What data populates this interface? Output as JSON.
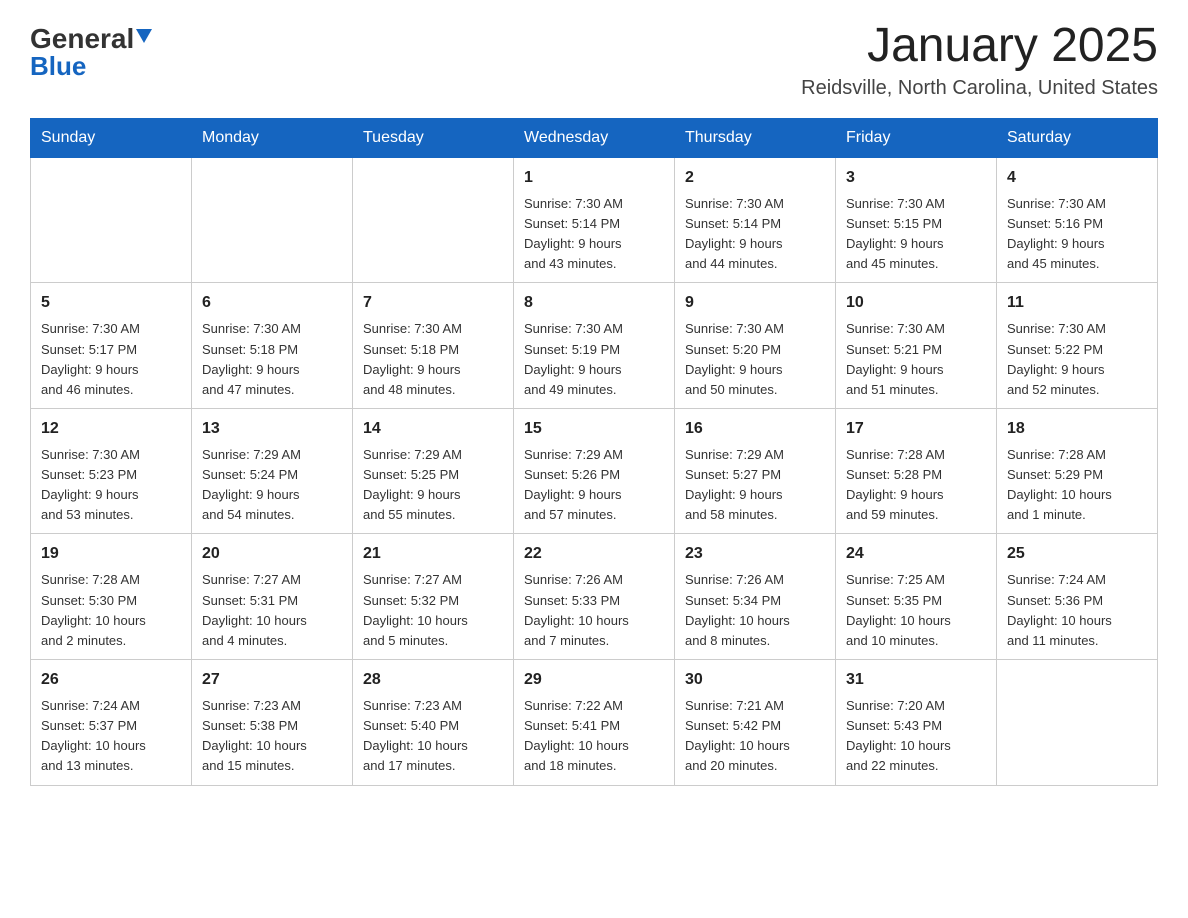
{
  "logo": {
    "brand": "General",
    "brand_color": "Blue"
  },
  "title": "January 2025",
  "subtitle": "Reidsville, North Carolina, United States",
  "days_of_week": [
    "Sunday",
    "Monday",
    "Tuesday",
    "Wednesday",
    "Thursday",
    "Friday",
    "Saturday"
  ],
  "weeks": [
    [
      {
        "day": "",
        "info": ""
      },
      {
        "day": "",
        "info": ""
      },
      {
        "day": "",
        "info": ""
      },
      {
        "day": "1",
        "info": "Sunrise: 7:30 AM\nSunset: 5:14 PM\nDaylight: 9 hours\nand 43 minutes."
      },
      {
        "day": "2",
        "info": "Sunrise: 7:30 AM\nSunset: 5:14 PM\nDaylight: 9 hours\nand 44 minutes."
      },
      {
        "day": "3",
        "info": "Sunrise: 7:30 AM\nSunset: 5:15 PM\nDaylight: 9 hours\nand 45 minutes."
      },
      {
        "day": "4",
        "info": "Sunrise: 7:30 AM\nSunset: 5:16 PM\nDaylight: 9 hours\nand 45 minutes."
      }
    ],
    [
      {
        "day": "5",
        "info": "Sunrise: 7:30 AM\nSunset: 5:17 PM\nDaylight: 9 hours\nand 46 minutes."
      },
      {
        "day": "6",
        "info": "Sunrise: 7:30 AM\nSunset: 5:18 PM\nDaylight: 9 hours\nand 47 minutes."
      },
      {
        "day": "7",
        "info": "Sunrise: 7:30 AM\nSunset: 5:18 PM\nDaylight: 9 hours\nand 48 minutes."
      },
      {
        "day": "8",
        "info": "Sunrise: 7:30 AM\nSunset: 5:19 PM\nDaylight: 9 hours\nand 49 minutes."
      },
      {
        "day": "9",
        "info": "Sunrise: 7:30 AM\nSunset: 5:20 PM\nDaylight: 9 hours\nand 50 minutes."
      },
      {
        "day": "10",
        "info": "Sunrise: 7:30 AM\nSunset: 5:21 PM\nDaylight: 9 hours\nand 51 minutes."
      },
      {
        "day": "11",
        "info": "Sunrise: 7:30 AM\nSunset: 5:22 PM\nDaylight: 9 hours\nand 52 minutes."
      }
    ],
    [
      {
        "day": "12",
        "info": "Sunrise: 7:30 AM\nSunset: 5:23 PM\nDaylight: 9 hours\nand 53 minutes."
      },
      {
        "day": "13",
        "info": "Sunrise: 7:29 AM\nSunset: 5:24 PM\nDaylight: 9 hours\nand 54 minutes."
      },
      {
        "day": "14",
        "info": "Sunrise: 7:29 AM\nSunset: 5:25 PM\nDaylight: 9 hours\nand 55 minutes."
      },
      {
        "day": "15",
        "info": "Sunrise: 7:29 AM\nSunset: 5:26 PM\nDaylight: 9 hours\nand 57 minutes."
      },
      {
        "day": "16",
        "info": "Sunrise: 7:29 AM\nSunset: 5:27 PM\nDaylight: 9 hours\nand 58 minutes."
      },
      {
        "day": "17",
        "info": "Sunrise: 7:28 AM\nSunset: 5:28 PM\nDaylight: 9 hours\nand 59 minutes."
      },
      {
        "day": "18",
        "info": "Sunrise: 7:28 AM\nSunset: 5:29 PM\nDaylight: 10 hours\nand 1 minute."
      }
    ],
    [
      {
        "day": "19",
        "info": "Sunrise: 7:28 AM\nSunset: 5:30 PM\nDaylight: 10 hours\nand 2 minutes."
      },
      {
        "day": "20",
        "info": "Sunrise: 7:27 AM\nSunset: 5:31 PM\nDaylight: 10 hours\nand 4 minutes."
      },
      {
        "day": "21",
        "info": "Sunrise: 7:27 AM\nSunset: 5:32 PM\nDaylight: 10 hours\nand 5 minutes."
      },
      {
        "day": "22",
        "info": "Sunrise: 7:26 AM\nSunset: 5:33 PM\nDaylight: 10 hours\nand 7 minutes."
      },
      {
        "day": "23",
        "info": "Sunrise: 7:26 AM\nSunset: 5:34 PM\nDaylight: 10 hours\nand 8 minutes."
      },
      {
        "day": "24",
        "info": "Sunrise: 7:25 AM\nSunset: 5:35 PM\nDaylight: 10 hours\nand 10 minutes."
      },
      {
        "day": "25",
        "info": "Sunrise: 7:24 AM\nSunset: 5:36 PM\nDaylight: 10 hours\nand 11 minutes."
      }
    ],
    [
      {
        "day": "26",
        "info": "Sunrise: 7:24 AM\nSunset: 5:37 PM\nDaylight: 10 hours\nand 13 minutes."
      },
      {
        "day": "27",
        "info": "Sunrise: 7:23 AM\nSunset: 5:38 PM\nDaylight: 10 hours\nand 15 minutes."
      },
      {
        "day": "28",
        "info": "Sunrise: 7:23 AM\nSunset: 5:40 PM\nDaylight: 10 hours\nand 17 minutes."
      },
      {
        "day": "29",
        "info": "Sunrise: 7:22 AM\nSunset: 5:41 PM\nDaylight: 10 hours\nand 18 minutes."
      },
      {
        "day": "30",
        "info": "Sunrise: 7:21 AM\nSunset: 5:42 PM\nDaylight: 10 hours\nand 20 minutes."
      },
      {
        "day": "31",
        "info": "Sunrise: 7:20 AM\nSunset: 5:43 PM\nDaylight: 10 hours\nand 22 minutes."
      },
      {
        "day": "",
        "info": ""
      }
    ]
  ]
}
